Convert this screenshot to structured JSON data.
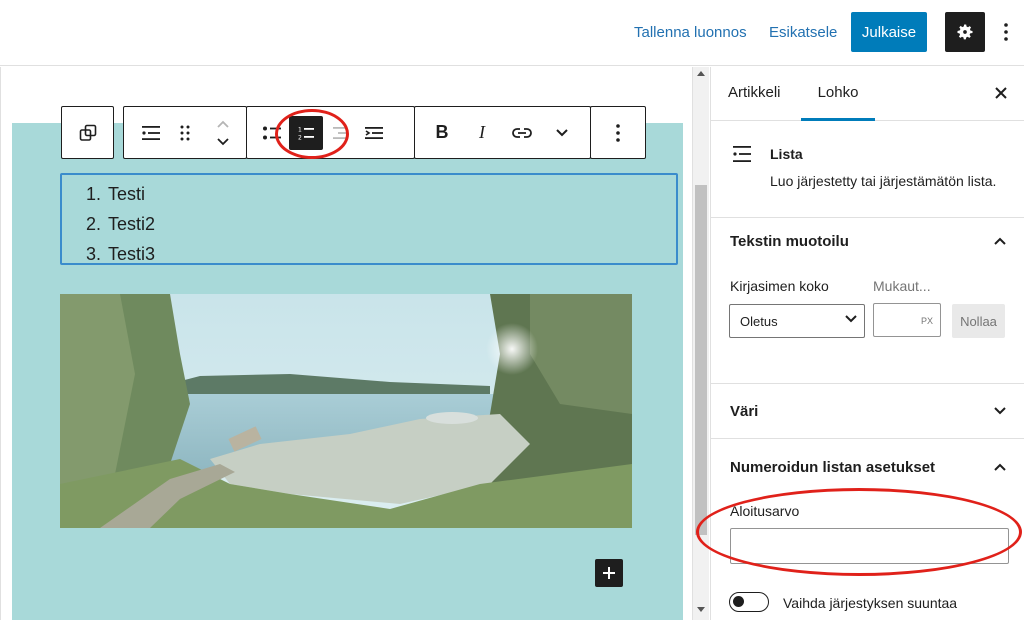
{
  "header": {
    "save_draft": "Tallenna luonnos",
    "preview": "Esikatsele",
    "publish": "Julkaise"
  },
  "editor": {
    "list_items": [
      "Testi",
      "Testi2",
      "Testi3"
    ],
    "group_background": "#a8d9d9",
    "selection_color": "#3a8ccc"
  },
  "toolbar": {
    "buttons": [
      "transform-icon",
      "list-icon",
      "drag-handle-icon",
      "move-up-icon",
      "move-down-icon",
      "unordered-list-icon",
      "ordered-list-icon",
      "outdent-icon",
      "indent-icon",
      "bold-icon",
      "italic-icon",
      "link-icon",
      "more-options-chevron-icon",
      "block-options-icon"
    ],
    "bold": "B",
    "italic": "I"
  },
  "sidebar": {
    "tabs": [
      "Artikkeli",
      "Lohko"
    ],
    "active_tab": "Lohko",
    "block": {
      "title": "Lista",
      "description": "Luo järjestetty tai järjestämätön lista."
    },
    "typography": {
      "heading": "Tekstin muotoilu",
      "font_size_label": "Kirjasimen koko",
      "custom_label": "Mukaut...",
      "font_size_value": "Oletus",
      "unit": "PX",
      "reset": "Nollaa"
    },
    "color": {
      "heading": "Väri"
    },
    "numbered_list": {
      "heading": "Numeroidun listan asetukset",
      "start_label": "Aloitusarvo",
      "start_value": "",
      "reverse_label": "Vaihda järjestyksen suuntaa",
      "reverse_on": false
    }
  },
  "colors": {
    "accent": "#007cba",
    "annotation": "#e0211a",
    "dark": "#1e1e1e"
  }
}
